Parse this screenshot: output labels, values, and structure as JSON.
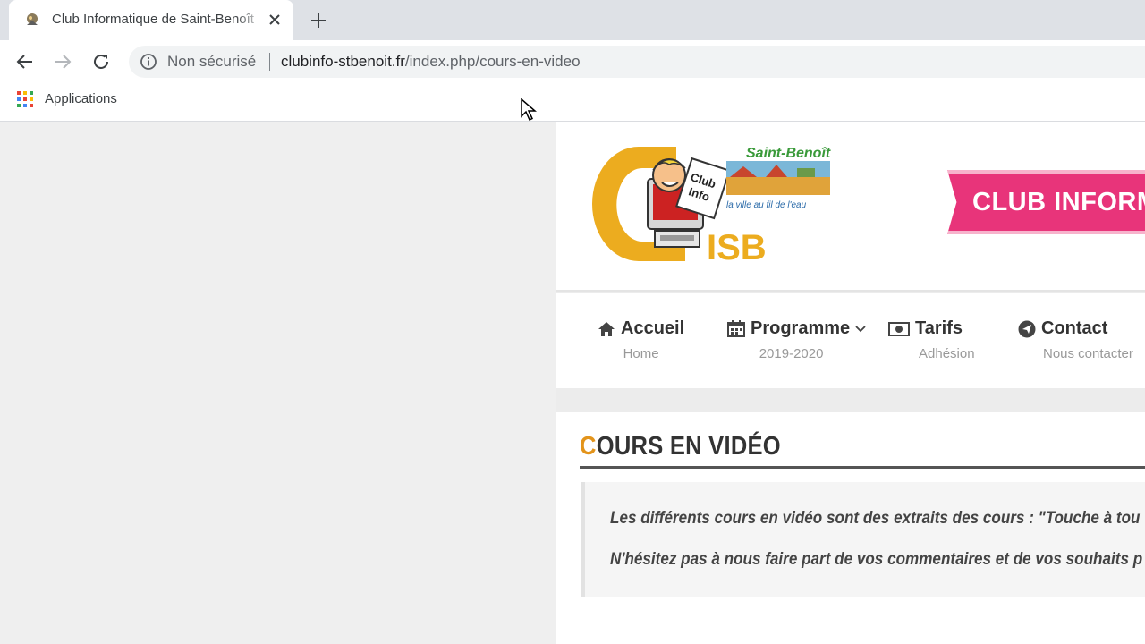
{
  "browser": {
    "tab": {
      "title": "Club Informatique de Saint-Benoît"
    },
    "omnibox": {
      "security_label": "Non sécurisé",
      "url_host": "clubinfo-stbenoit.fr",
      "url_path": "/index.php/cours-en-video"
    },
    "bookmarks": {
      "apps_label": "Applications"
    }
  },
  "site": {
    "logo": {
      "text_top": "Saint-Benoît",
      "tagline": "la ville au fil de l'eau",
      "club_text": "Club Info",
      "acronym": "ISB"
    },
    "banner": {
      "text": "CLUB INFORM"
    },
    "menu": [
      {
        "label": "Accueil",
        "sub": "Home",
        "icon": "home-icon"
      },
      {
        "label": "Programme",
        "sub": "2019-2020",
        "icon": "calendar-icon"
      },
      {
        "label": "Tarifs",
        "sub": "Adhésion",
        "icon": "money-icon"
      },
      {
        "label": "Contact",
        "sub": "Nous contacter",
        "icon": "send-icon"
      }
    ],
    "page": {
      "title_first_letter": "C",
      "title_rest": "OURS EN VIDÉO",
      "paragraph1": "Les différents cours en vidéo sont des extraits des cours : \"Touche à tou",
      "paragraph2": "N'hésitez pas à nous faire part de vos commentaires et de vos souhaits p"
    }
  },
  "colors": {
    "accent_orange": "#e3941b",
    "banner_pink": "#e8347a",
    "logo_yellow": "#ecac1f"
  }
}
